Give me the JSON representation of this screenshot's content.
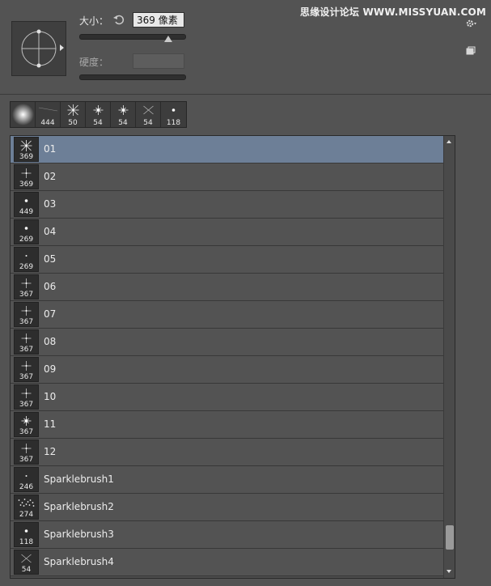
{
  "watermark": "思缘设计论坛  WWW.MISSYUAN.COM",
  "controls": {
    "size_label": "大小：",
    "size_value": "369 像素",
    "size_level": 0.83,
    "hardness_label": "硬度："
  },
  "recent_brushes": [
    {
      "size": "",
      "shape": "soft-round"
    },
    {
      "size": "444",
      "shape": "line"
    },
    {
      "size": "50",
      "shape": "star"
    },
    {
      "size": "54",
      "shape": "sparkle"
    },
    {
      "size": "54",
      "shape": "sparkle"
    },
    {
      "size": "54",
      "shape": "cross"
    },
    {
      "size": "118",
      "shape": "dot"
    }
  ],
  "brushes": [
    {
      "name": "01",
      "size": "369",
      "shape": "star",
      "selected": true
    },
    {
      "name": "02",
      "size": "369",
      "shape": "cross-thin"
    },
    {
      "name": "03",
      "size": "449",
      "shape": "dot"
    },
    {
      "name": "04",
      "size": "269",
      "shape": "dot"
    },
    {
      "name": "05",
      "size": "269",
      "shape": "small-dot"
    },
    {
      "name": "06",
      "size": "367",
      "shape": "cross-thin"
    },
    {
      "name": "07",
      "size": "367",
      "shape": "cross-thin"
    },
    {
      "name": "08",
      "size": "367",
      "shape": "cross-thin"
    },
    {
      "name": "09",
      "size": "367",
      "shape": "cross-thin"
    },
    {
      "name": "10",
      "size": "367",
      "shape": "cross-thin"
    },
    {
      "name": "11",
      "size": "367",
      "shape": "sparkle"
    },
    {
      "name": "12",
      "size": "367",
      "shape": "cross-thin"
    },
    {
      "name": "Sparklebrush1",
      "size": "246",
      "shape": "small-dot"
    },
    {
      "name": "Sparklebrush2",
      "size": "274",
      "shape": "scatter"
    },
    {
      "name": "Sparklebrush3",
      "size": "118",
      "shape": "dot"
    },
    {
      "name": "Sparklebrush4",
      "size": "54",
      "shape": "cross"
    }
  ],
  "icons": {
    "reset": "reset-icon",
    "gear": "gear-icon",
    "new_preset": "new-preset-icon",
    "preview": "brush-angle-preview-icon"
  }
}
